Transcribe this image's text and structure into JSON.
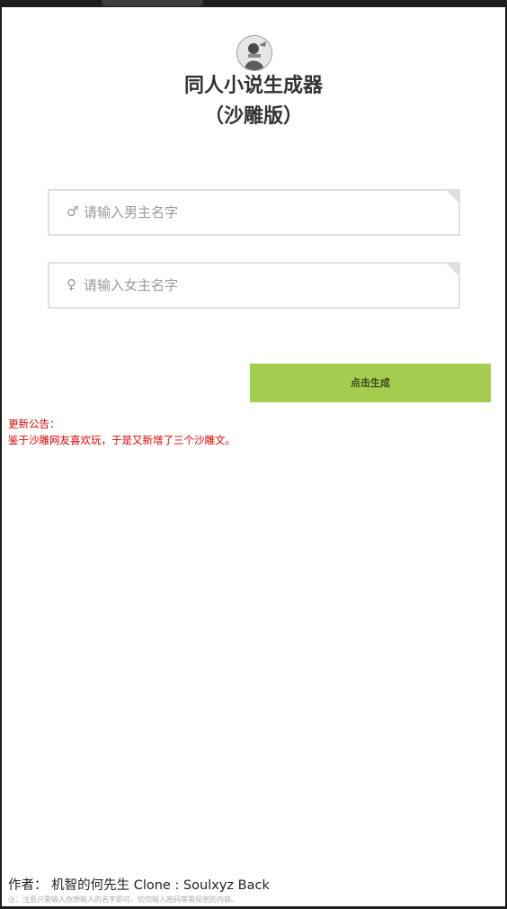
{
  "header": {
    "title_line1": "同人小说生成器",
    "title_line2": "（沙雕版）"
  },
  "form": {
    "male_symbol": "♂",
    "male_placeholder": "请输入男主名字",
    "female_symbol": "♀",
    "female_placeholder": "请输入女主名字",
    "generate_label": "点击生成"
  },
  "notice": {
    "title": "更新公告：",
    "body": "鉴于沙雕网友喜欢玩，于是又新增了三个沙雕文。"
  },
  "footer": {
    "author_line": "作者：  机智的何先生 Clone : Soulxyz Back",
    "note": "注：注意只需输入你想输入的名字即可，切勿输入密码等需保密的内容。"
  },
  "colors": {
    "button": "#a4cc4e",
    "notice": "#e60000",
    "title": "#333333"
  }
}
